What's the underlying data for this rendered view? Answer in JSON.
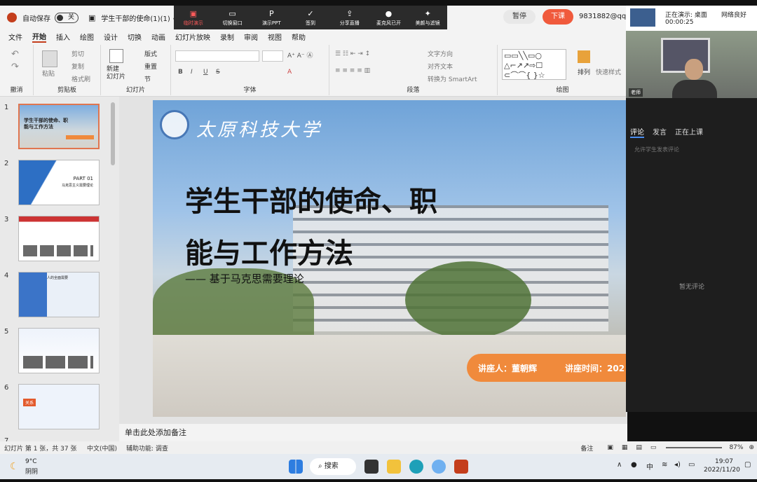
{
  "titlebar": {
    "autosave_label": "自动保存",
    "toggle_label": "关",
    "doc_title": "学生干部的使命(1)(1) • 已保存"
  },
  "meeting": {
    "items": [
      {
        "label": "临时演示",
        "icon": "present-icon"
      },
      {
        "label": "切换窗口",
        "icon": "window-icon"
      },
      {
        "label": "演示PPT",
        "icon": "ppt-icon"
      },
      {
        "label": "签到",
        "icon": "checkin-icon"
      },
      {
        "label": "分享直播",
        "icon": "share-icon"
      },
      {
        "label": "麦克风已开",
        "icon": "mic-icon"
      },
      {
        "label": "美颜与滤镜",
        "icon": "beauty-icon"
      }
    ],
    "pause_label": "暂停",
    "end_label": "下课",
    "account": "9831882@qq."
  },
  "menu": [
    "文件",
    "开始",
    "插入",
    "绘图",
    "设计",
    "切换",
    "动画",
    "幻灯片放映",
    "录制",
    "审阅",
    "视图",
    "帮助"
  ],
  "ribbon": {
    "undo_group": "撤消",
    "clipboard": {
      "label": "剪贴板",
      "paste": "粘贴",
      "cut": "剪切",
      "copy": "复制",
      "format_painter": "格式刷"
    },
    "slides": {
      "label": "幻灯片",
      "new_slide": "新建\n幻灯片",
      "layout": "版式",
      "reset": "重置",
      "section": "节"
    },
    "font": {
      "label": "字体",
      "bold": "B",
      "italic": "I",
      "underline": "U",
      "strike": "S"
    },
    "paragraph": {
      "label": "段落",
      "text_direction": "文字方向",
      "align_text": "对齐文本",
      "smartart": "转换为 SmartArt"
    },
    "drawing": {
      "label": "绘图",
      "arrange": "排列",
      "quick_styles": "快速样式"
    }
  },
  "thumbnails": [
    {
      "num": "1",
      "title": "学生干部的使命、职能与工作方法"
    },
    {
      "num": "2",
      "title": "PART 01",
      "subtitle": "马克思主义需要理论"
    },
    {
      "num": "3",
      "title": ""
    },
    {
      "num": "4",
      "title": "人的全面需要"
    },
    {
      "num": "5",
      "title": ""
    },
    {
      "num": "6",
      "title": "关系"
    },
    {
      "num": "7",
      "title": ""
    }
  ],
  "slide": {
    "university": "太原科技大学",
    "title_line1": "学生干部的使命、职",
    "title_line2": "能与工作方法",
    "subtitle": "—— 基于马克思需要理论",
    "speaker": "讲座人：董朝辉",
    "time": "讲座时间：202"
  },
  "notes_placeholder": "单击此处添加备注",
  "status": {
    "slide_info": "幻灯片 第 1 张，共 37 张",
    "language": "中文(中国)",
    "accessibility": "辅助功能: 调查",
    "notes": "备注",
    "zoom": "87%"
  },
  "camera": {
    "sharing": "正在演示: 桌面",
    "timer": "00:00:25",
    "network": "网络良好",
    "teacher_label": "老师"
  },
  "side": {
    "tabs": [
      "评论",
      "发言",
      "正在上课"
    ],
    "allow_comment": "允许学生发表评论",
    "empty": "暂无评论"
  },
  "taskbar": {
    "weather_temp": "9°C",
    "weather_desc": "阴阴",
    "search_label": "搜索",
    "ime": "中",
    "time": "19:07",
    "date": "2022/11/20"
  }
}
